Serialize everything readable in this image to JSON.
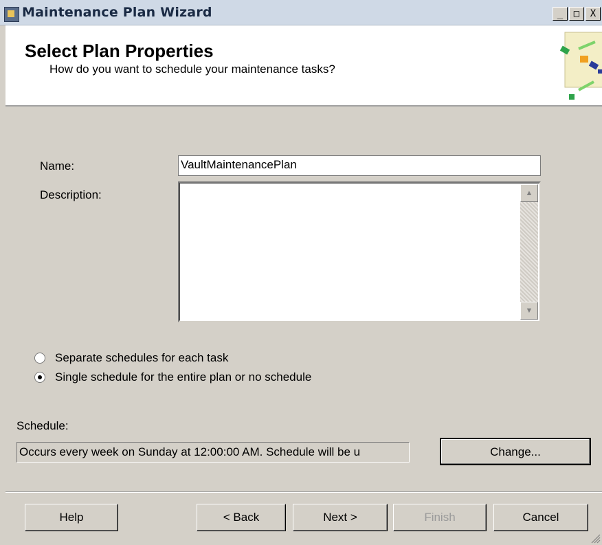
{
  "window": {
    "title": "Maintenance Plan Wizard",
    "controls": [
      "_",
      "□",
      "X"
    ]
  },
  "header": {
    "title": "Select Plan Properties",
    "subtitle": "How do you want to schedule your maintenance tasks?"
  },
  "form": {
    "name_label": "Name:",
    "name_value": "VaultMaintenancePlan",
    "description_label": "Description:",
    "description_value": ""
  },
  "options": {
    "separate_label": "Separate schedules for each task",
    "single_label": "Single schedule for the entire plan or no schedule",
    "selected": "single"
  },
  "schedule": {
    "label": "Schedule:",
    "value": "Occurs every week on Sunday at 12:00:00 AM. Schedule will be u",
    "change_label": "Change..."
  },
  "footer": {
    "help": "Help",
    "back": "< Back",
    "next": "Next >",
    "finish": "Finish",
    "cancel": "Cancel"
  }
}
